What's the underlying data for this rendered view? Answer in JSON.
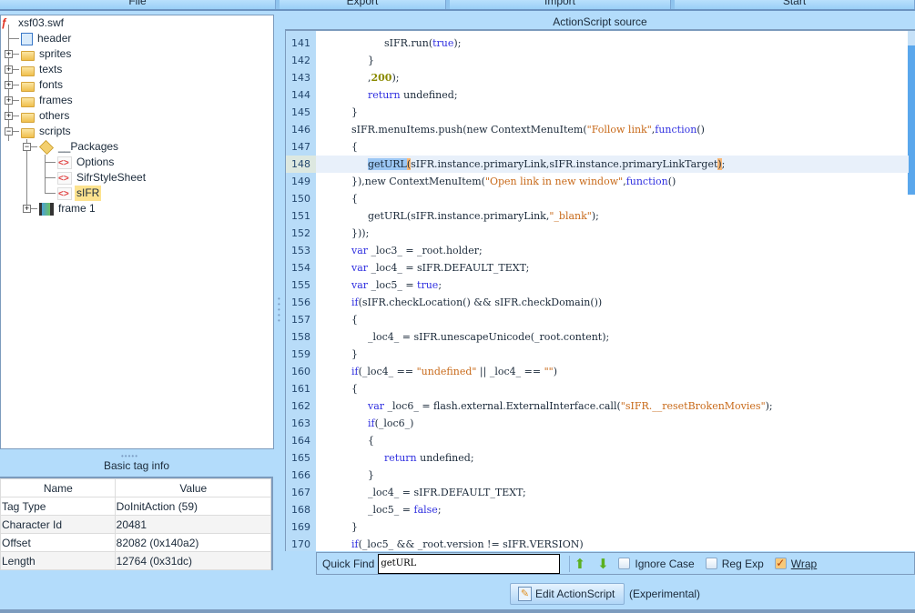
{
  "menu_tabs": [
    "File",
    "Export",
    "Import",
    "Start"
  ],
  "tree": {
    "root": "xsf03.swf",
    "items": [
      {
        "label": "header",
        "icon": "header-icon"
      },
      {
        "label": "sprites",
        "icon": "folder-sprites-icon"
      },
      {
        "label": "texts",
        "icon": "folder-texts-icon"
      },
      {
        "label": "fonts",
        "icon": "folder-fonts-icon"
      },
      {
        "label": "frames",
        "icon": "folder-frames-icon"
      },
      {
        "label": "others",
        "icon": "folder-icon"
      },
      {
        "label": "scripts",
        "icon": "folder-scripts-icon"
      },
      {
        "label": "__Packages",
        "icon": "package-icon"
      },
      {
        "label": "Options",
        "icon": "script-icon"
      },
      {
        "label": "SifrStyleSheet",
        "icon": "script-icon"
      },
      {
        "label": "sIFR",
        "icon": "script-icon",
        "selected": true
      },
      {
        "label": "frame 1",
        "icon": "frame-icon"
      }
    ]
  },
  "tag_info": {
    "title": "Basic tag info",
    "headers": [
      "Name",
      "Value"
    ],
    "rows": [
      [
        "Tag Type",
        "DoInitAction (59)"
      ],
      [
        "Character Id",
        "20481"
      ],
      [
        "Offset",
        "82082 (0x140a2)"
      ],
      [
        "Length",
        "12764 (0x31dc)"
      ]
    ]
  },
  "source": {
    "title": "ActionScript source",
    "current_line": 148,
    "lines": [
      {
        "n": "141",
        "i": 2,
        "s": [
          [
            "sIFR.run(",
            ""
          ],
          [
            "true",
            "kw"
          ],
          [
            ");",
            ""
          ]
        ]
      },
      {
        "n": "142",
        "i": 1,
        "s": [
          [
            "}",
            ""
          ]
        ]
      },
      {
        "n": "143",
        "i": 1,
        "s": [
          [
            ",",
            ""
          ],
          [
            "200",
            "num"
          ],
          [
            ");",
            ""
          ]
        ]
      },
      {
        "n": "144",
        "i": 1,
        "s": [
          [
            "return",
            "kw"
          ],
          [
            " undefined;",
            ""
          ]
        ]
      },
      {
        "n": "145",
        "i": 0,
        "s": [
          [
            "}",
            ""
          ]
        ]
      },
      {
        "n": "146",
        "i": 0,
        "s": [
          [
            "sIFR.menuItems.push(new ContextMenuItem(",
            ""
          ],
          [
            "\"Follow link\"",
            "str"
          ],
          [
            ",",
            ""
          ],
          [
            "function",
            "kw"
          ],
          [
            "()",
            ""
          ]
        ]
      },
      {
        "n": "147",
        "i": 0,
        "s": [
          [
            "{",
            ""
          ]
        ]
      },
      {
        "n": "148",
        "i": 1,
        "s": [
          [
            "getURL",
            "mark"
          ],
          [
            "(",
            "br"
          ],
          [
            "sIFR.instance.primaryLink,sIFR.instance.primaryLinkTarget",
            ""
          ],
          [
            ")",
            "br"
          ],
          [
            ";",
            ""
          ]
        ]
      },
      {
        "n": "149",
        "i": 0,
        "s": [
          [
            "}),new ContextMenuItem(",
            ""
          ],
          [
            "\"Open link in new window\"",
            "str"
          ],
          [
            ",",
            ""
          ],
          [
            "function",
            "kw"
          ],
          [
            "()",
            ""
          ]
        ]
      },
      {
        "n": "150",
        "i": 0,
        "s": [
          [
            "{",
            ""
          ]
        ]
      },
      {
        "n": "151",
        "i": 1,
        "s": [
          [
            "getURL(sIFR.instance.primaryLink,",
            ""
          ],
          [
            "\"_blank\"",
            "str"
          ],
          [
            ");",
            ""
          ]
        ]
      },
      {
        "n": "152",
        "i": 0,
        "s": [
          [
            "}));",
            ""
          ]
        ]
      },
      {
        "n": "153",
        "i": 0,
        "s": [
          [
            "var",
            "kw"
          ],
          [
            " _loc3_ = _root.holder;",
            ""
          ]
        ]
      },
      {
        "n": "154",
        "i": 0,
        "s": [
          [
            "var",
            "kw"
          ],
          [
            " _loc4_ = sIFR.DEFAULT_TEXT;",
            ""
          ]
        ]
      },
      {
        "n": "155",
        "i": 0,
        "s": [
          [
            "var",
            "kw"
          ],
          [
            " _loc5_ = ",
            ""
          ],
          [
            "true",
            "kw"
          ],
          [
            ";",
            ""
          ]
        ]
      },
      {
        "n": "156",
        "i": 0,
        "s": [
          [
            "if",
            "kw"
          ],
          [
            "(sIFR.checkLocation() && sIFR.checkDomain())",
            ""
          ]
        ]
      },
      {
        "n": "157",
        "i": 0,
        "s": [
          [
            "{",
            ""
          ]
        ]
      },
      {
        "n": "158",
        "i": 1,
        "s": [
          [
            "_loc4_ = sIFR.unescapeUnicode(_root.content);",
            ""
          ]
        ]
      },
      {
        "n": "159",
        "i": 0,
        "s": [
          [
            "}",
            ""
          ]
        ]
      },
      {
        "n": "160",
        "i": 0,
        "s": [
          [
            "if",
            "kw"
          ],
          [
            "(_loc4_ == ",
            ""
          ],
          [
            "\"undefined\"",
            "str"
          ],
          [
            " || _loc4_ == ",
            ""
          ],
          [
            "\"\"",
            "str"
          ],
          [
            ")",
            ""
          ]
        ]
      },
      {
        "n": "161",
        "i": 0,
        "s": [
          [
            "{",
            ""
          ]
        ]
      },
      {
        "n": "162",
        "i": 1,
        "s": [
          [
            "var",
            "kw"
          ],
          [
            " _loc6_ = flash.external.ExternalInterface.call(",
            ""
          ],
          [
            "\"sIFR.__resetBrokenMovies\"",
            "str"
          ],
          [
            ");",
            ""
          ]
        ]
      },
      {
        "n": "163",
        "i": 1,
        "s": [
          [
            "if",
            "kw"
          ],
          [
            "(_loc6_)",
            ""
          ]
        ]
      },
      {
        "n": "164",
        "i": 1,
        "s": [
          [
            "{",
            ""
          ]
        ]
      },
      {
        "n": "165",
        "i": 2,
        "s": [
          [
            "return",
            "kw"
          ],
          [
            " undefined;",
            ""
          ]
        ]
      },
      {
        "n": "166",
        "i": 1,
        "s": [
          [
            "}",
            ""
          ]
        ]
      },
      {
        "n": "167",
        "i": 1,
        "s": [
          [
            "_loc4_ = sIFR.DEFAULT_TEXT;",
            ""
          ]
        ]
      },
      {
        "n": "168",
        "i": 1,
        "s": [
          [
            "_loc5_ = ",
            ""
          ],
          [
            "false",
            "kw"
          ],
          [
            ";",
            ""
          ]
        ]
      },
      {
        "n": "169",
        "i": 0,
        "s": [
          [
            "}",
            ""
          ]
        ]
      },
      {
        "n": "170",
        "i": 0,
        "s": [
          [
            "if",
            "kw"
          ],
          [
            "(_loc5_ && _root.version != sIFR.VERSION)",
            ""
          ]
        ]
      }
    ]
  },
  "quick_find": {
    "label": "Quick Find",
    "value": "getURL",
    "ignore_case": "Ignore Case",
    "ignore_case_checked": false,
    "reg_exp": "Reg Exp",
    "reg_exp_checked": false,
    "wrap": "Wrap",
    "wrap_checked": true
  },
  "edit_button": "Edit ActionScript",
  "experimental": "(Experimental)"
}
